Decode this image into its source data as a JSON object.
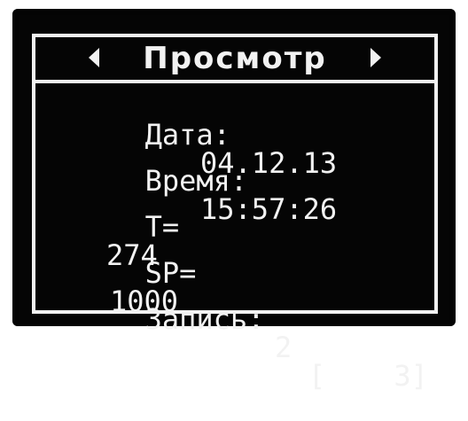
{
  "screen": {
    "title": "Просмотр",
    "nav_left_icon": "chevron-left-icon",
    "nav_right_icon": "chevron-right-icon",
    "colors": {
      "background": "#050505",
      "foreground": "#f2f2f2"
    }
  },
  "fields": {
    "date": {
      "label": "Дата:",
      "value": "04.12.13"
    },
    "time": {
      "label": "Время:",
      "value": "15:57:26"
    },
    "temperature": {
      "label": "T=",
      "value": "274"
    },
    "setpoint": {
      "label": "SP=",
      "value": "1000"
    },
    "record": {
      "label": "Запись:",
      "value": "2",
      "total": "[    3]"
    }
  }
}
